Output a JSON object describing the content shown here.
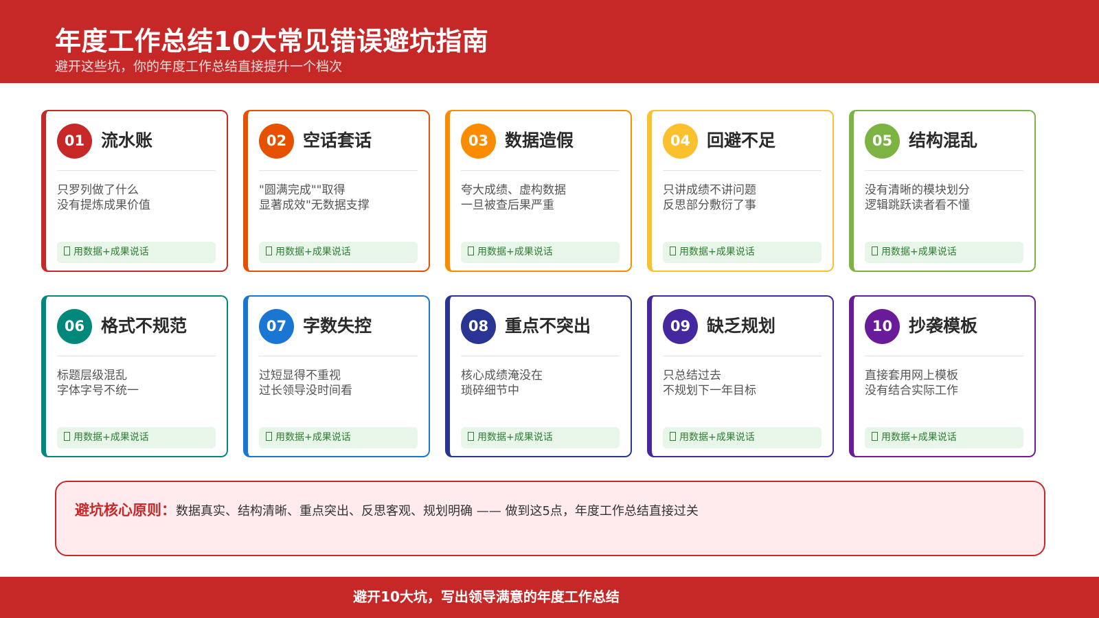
{
  "header": {
    "title": "年度工作总结10大常见错误避坑指南",
    "subtitle": "避开这些坑，你的年度工作总结直接提升一个档次"
  },
  "cards": [
    {
      "num": "01",
      "title": "流水账",
      "lines": [
        "只罗列做了什么",
        "没有提炼成果价值"
      ],
      "tip": "用数据+成果说话",
      "color": "#c62828"
    },
    {
      "num": "02",
      "title": "空话套话",
      "lines": [
        "\"圆满完成\"\"取得",
        "显著成效\"无数据支撑"
      ],
      "tip": "用数据+成果说话",
      "color": "#e65100"
    },
    {
      "num": "03",
      "title": "数据造假",
      "lines": [
        "夸大成绩、虚构数据",
        "一旦被查后果严重"
      ],
      "tip": "用数据+成果说话",
      "color": "#fb8c00"
    },
    {
      "num": "04",
      "title": "回避不足",
      "lines": [
        "只讲成绩不讲问题",
        "反思部分敷衍了事"
      ],
      "tip": "用数据+成果说话",
      "color": "#fbc02d"
    },
    {
      "num": "05",
      "title": "结构混乱",
      "lines": [
        "没有清晰的模块划分",
        "逻辑跳跃读者看不懂"
      ],
      "tip": "用数据+成果说话",
      "color": "#7cb342"
    },
    {
      "num": "06",
      "title": "格式不规范",
      "lines": [
        "标题层级混乱",
        "字体字号不统一"
      ],
      "tip": "用数据+成果说话",
      "color": "#00897b"
    },
    {
      "num": "07",
      "title": "字数失控",
      "lines": [
        "过短显得不重视",
        "过长领导没时间看"
      ],
      "tip": "用数据+成果说话",
      "color": "#1976d2"
    },
    {
      "num": "08",
      "title": "重点不突出",
      "lines": [
        "核心成绩淹没在",
        "琐碎细节中"
      ],
      "tip": "用数据+成果说话",
      "color": "#283593"
    },
    {
      "num": "09",
      "title": "缺乏规划",
      "lines": [
        "只总结过去",
        "不规划下一年目标"
      ],
      "tip": "用数据+成果说话",
      "color": "#4527a0"
    },
    {
      "num": "10",
      "title": "抄袭模板",
      "lines": [
        "直接套用网上模板",
        "没有结合实际工作"
      ],
      "tip": "用数据+成果说话",
      "color": "#6a1b9a"
    }
  ],
  "principle": {
    "label": "避坑核心原则：",
    "text": "数据真实、结构清晰、重点突出、反思客观、规划明确 —— 做到这5点，年度工作总结直接过关"
  },
  "footer": {
    "text": "避开10大坑，写出领导满意的年度工作总结"
  }
}
